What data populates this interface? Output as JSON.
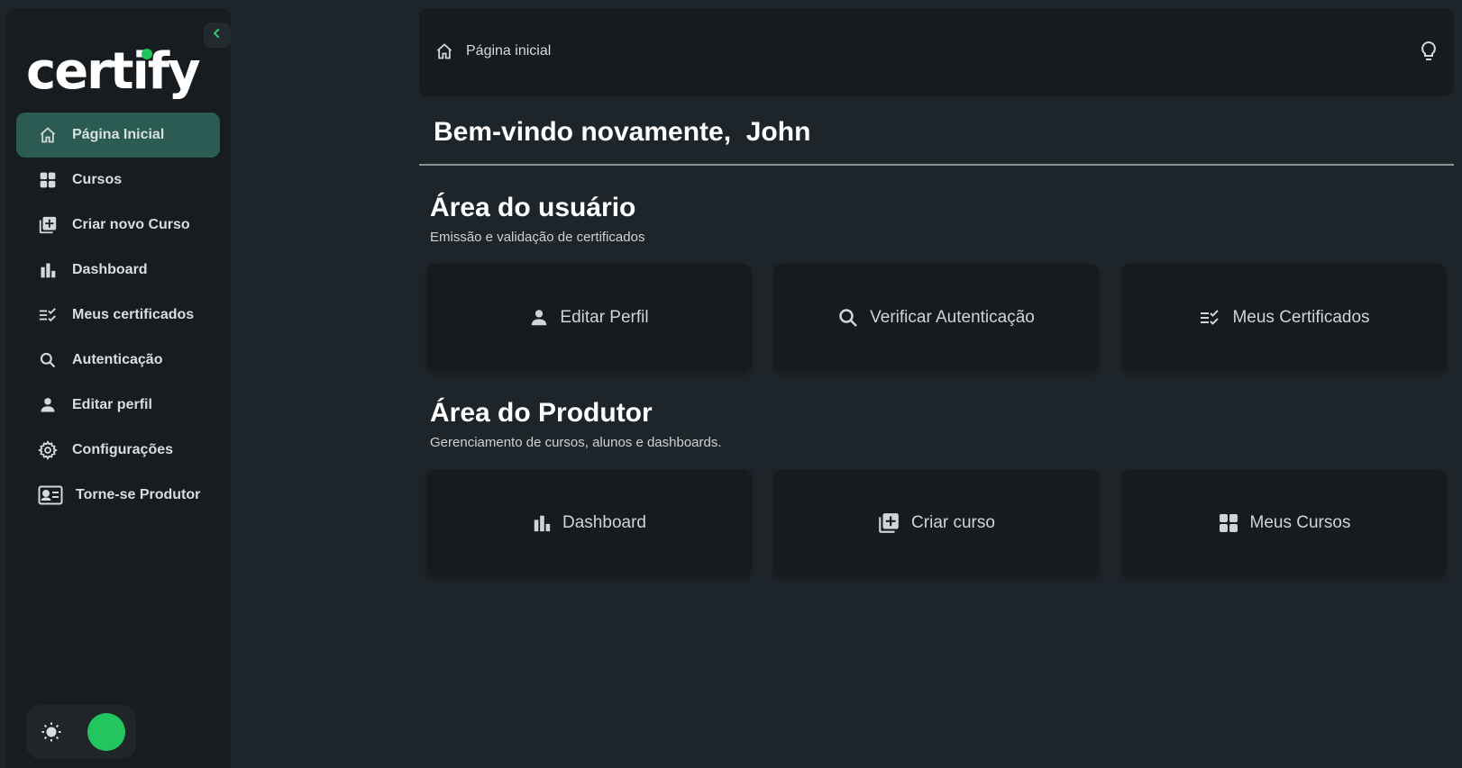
{
  "brand": {
    "logo_text": "certify",
    "accent": "#22c55e"
  },
  "sidebar": {
    "collapse_icon": "chevron-left-icon",
    "items": [
      {
        "label": "Página Inicial",
        "icon": "home-icon",
        "active": true
      },
      {
        "label": "Cursos",
        "icon": "grid-icon"
      },
      {
        "label": "Criar novo Curso",
        "icon": "library-add-icon"
      },
      {
        "label": "Dashboard",
        "icon": "bar-chart-icon"
      },
      {
        "label": "Meus certificados",
        "icon": "checklist-icon"
      },
      {
        "label": "Autenticação",
        "icon": "search-icon"
      },
      {
        "label": "Editar perfil",
        "icon": "person-icon"
      },
      {
        "label": "Configurações",
        "icon": "gear-icon"
      },
      {
        "label": "Torne-se Produtor",
        "icon": "id-card-icon"
      }
    ],
    "theme": {
      "light_icon": "sun-icon",
      "dark_icon": "moon-icon",
      "selected": "dark"
    }
  },
  "topbar": {
    "breadcrumb": "Página inicial",
    "right_icon": "lightbulb-icon"
  },
  "main": {
    "welcome": "Bem-vindo novamente,  John",
    "user_area": {
      "title": "Área do usuário",
      "subtitle": "Emissão e validação de certificados",
      "cards": [
        {
          "label": "Editar Perfil",
          "icon": "person-icon"
        },
        {
          "label": "Verificar Autenticação",
          "icon": "search-icon"
        },
        {
          "label": "Meus Certificados",
          "icon": "checklist-icon"
        }
      ]
    },
    "producer_area": {
      "title": "Área do Produtor",
      "subtitle": "Gerenciamento de cursos, alunos e dashboards.",
      "cards": [
        {
          "label": "Dashboard",
          "icon": "bar-chart-icon"
        },
        {
          "label": "Criar curso",
          "icon": "library-add-icon"
        },
        {
          "label": "Meus Cursos",
          "icon": "grid-icon"
        }
      ]
    }
  }
}
